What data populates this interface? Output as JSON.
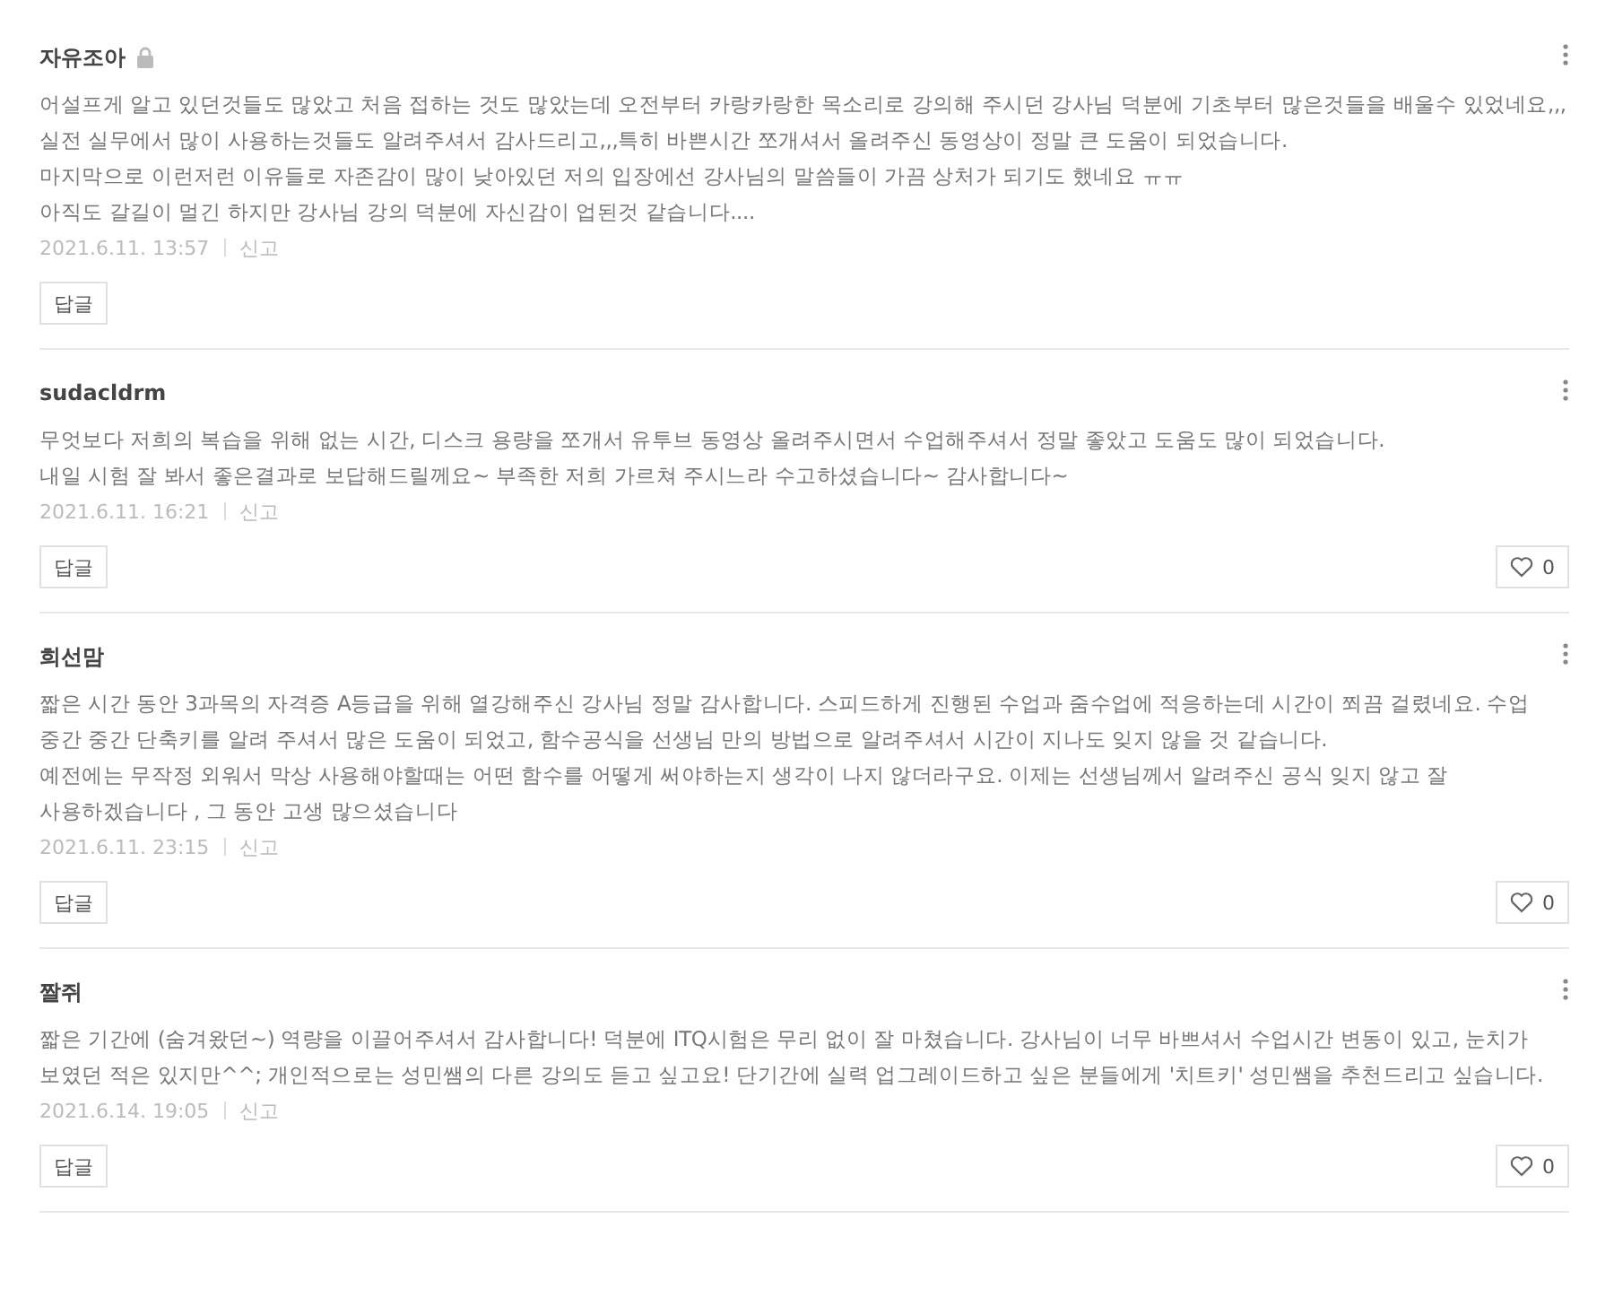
{
  "comments": [
    {
      "author": "자유조아",
      "locked": true,
      "paragraphs": [
        "어설프게 알고 있던것들도 많았고 처음 접하는 것도 많았는데 오전부터 카랑카랑한 목소리로 강의해 주시던 강사님 덕분에 기초부터 많은것들을 배울수 있었네요,,, 실전 실무에서 많이 사용하는것들도 알려주셔서 감사드리고,,,특히 바쁜시간 쪼개셔서 올려주신 동영상이 정말 큰 도움이 되었습니다.",
        "마지막으로 이런저런 이유들로 자존감이 많이 낮아있던 저의 입장에선 강사님의 말씀들이 가끔 상처가 되기도 했네요 ㅠㅠ",
        "아직도 갈길이 멀긴 하지만 강사님 강의 덕분에 자신감이 업된것 같습니다...."
      ],
      "date": "2021.6.11. 13:57",
      "report": "신고",
      "reply": "답글"
    },
    {
      "author": "sudacldrm",
      "locked": false,
      "paragraphs": [
        "무엇보다 저희의 복습을 위해 없는 시간, 디스크 용량을 쪼개서 유투브 동영상 올려주시면서 수업해주셔서 정말 좋았고 도움도 많이 되었습니다.",
        "내일 시험 잘 봐서 좋은결과로 보답해드릴께요~ 부족한 저희 가르쳐 주시느라 수고하셨습니다~ 감사합니다~"
      ],
      "date": "2021.6.11. 16:21",
      "report": "신고",
      "reply": "답글",
      "likes": "0"
    },
    {
      "author": "희선맘",
      "locked": false,
      "paragraphs": [
        "짧은 시간 동안 3과목의 자격증 A등급을 위해 열강해주신 강사님 정말 감사합니다. 스피드하게 진행된 수업과 줌수업에 적응하는데 시간이 쬐끔 걸렸네요. 수업 중간 중간 단축키를 알려 주셔서 많은 도움이 되었고, 함수공식을 선생님 만의 방법으로 알려주셔서 시간이 지나도 잊지 않을 것 같습니다.",
        "예전에는 무작정 외워서 막상 사용해야할때는 어떤 함수를 어떻게 써야하는지 생각이 나지 않더라구요. 이제는 선생님께서 알려주신 공식 잊지 않고 잘 사용하겠습니다 , 그 동안 고생 많으셨습니다"
      ],
      "date": "2021.6.11. 23:15",
      "report": "신고",
      "reply": "답글",
      "likes": "0"
    },
    {
      "author": "짤쥐",
      "locked": false,
      "paragraphs": [
        "짧은 기간에 (숨겨왔던~) 역량을 이끌어주셔서 감사합니다! 덕분에 ITQ시험은 무리 없이 잘 마쳤습니다. 강사님이 너무 바쁘셔서 수업시간 변동이 있고, 눈치가 보였던 적은 있지만^^; 개인적으로는 성민쌤의 다른 강의도 듣고 싶고요! 단기간에 실력 업그레이드하고 싶은 분들에게 '치트키' 성민쌤을 추천드리고 싶습니다."
      ],
      "date": "2021.6.14. 19:05",
      "report": "신고",
      "reply": "답글",
      "likes": "0"
    }
  ]
}
